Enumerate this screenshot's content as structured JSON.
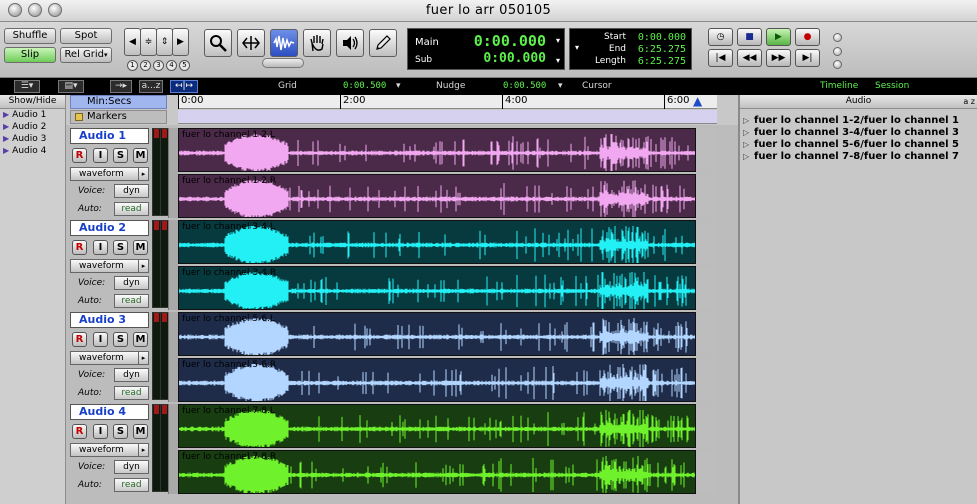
{
  "window": {
    "title": "fuer lo arr 050105"
  },
  "modes": {
    "shuffle": "Shuffle",
    "spot": "Spot",
    "slip": "Slip",
    "relgrid": "Rel Grid"
  },
  "zoom_presets": [
    "1",
    "2",
    "3",
    "4",
    "5"
  ],
  "counter": {
    "main_label": "Main",
    "main_value": "0:00.000",
    "sub_label": "Sub",
    "sub_value": "0:00.000"
  },
  "selection": {
    "start_label": "Start",
    "start_value": "0:00.000",
    "end_label": "End",
    "end_value": "6:25.275",
    "length_label": "Length",
    "length_value": "6:25.275"
  },
  "rulerbar": {
    "az": "a...z",
    "grid_label": "Grid",
    "grid_value": "0:00.500",
    "nudge_label": "Nudge",
    "nudge_value": "0:00.500",
    "cursor_label": "Cursor",
    "timeline_tab": "Timeline",
    "session_tab": "Session"
  },
  "showhide": {
    "header": "Show/Hide",
    "items": [
      "Audio 1",
      "Audio 2",
      "Audio 3",
      "Audio 4"
    ]
  },
  "timeline": {
    "ruler_label": "Min:Secs",
    "markers_label": "Markers",
    "ticks": [
      "0:00",
      "2:00",
      "4:00",
      "6:00"
    ]
  },
  "tracks": [
    {
      "name": "Audio 1",
      "rec": "R",
      "input": "I",
      "solo": "S",
      "mute": "M",
      "view": "waveform",
      "voice_label": "Voice:",
      "voice": "dyn",
      "auto_label": "Auto:",
      "auto": "read",
      "color": "#f2a8f0",
      "bg": "#4a2a48",
      "regions": [
        "fuer lo channel 1-2.L",
        "fuer lo channel 1-2.R"
      ]
    },
    {
      "name": "Audio 2",
      "rec": "R",
      "input": "I",
      "solo": "S",
      "mute": "M",
      "view": "waveform",
      "voice_label": "Voice:",
      "voice": "dyn",
      "auto_label": "Auto:",
      "auto": "read",
      "color": "#22f0f4",
      "bg": "#063a3e",
      "regions": [
        "fuer lo channel 3-4.L",
        "fuer lo channel 3-4.R"
      ]
    },
    {
      "name": "Audio 3",
      "rec": "R",
      "input": "I",
      "solo": "S",
      "mute": "M",
      "view": "waveform",
      "voice_label": "Voice:",
      "voice": "dyn",
      "auto_label": "Auto:",
      "auto": "read",
      "color": "#b2d6ff",
      "bg": "#1e2c4a",
      "regions": [
        "fuer lo channel 5-6.L",
        "fuer lo channel 5-6.R"
      ]
    },
    {
      "name": "Audio 4",
      "rec": "R",
      "input": "I",
      "solo": "S",
      "mute": "M",
      "view": "waveform",
      "voice_label": "Voice:",
      "voice": "dyn",
      "auto_label": "Auto:",
      "auto": "read",
      "color": "#6ff22c",
      "bg": "#173d10",
      "regions": [
        "fuer lo channel 7-8.L",
        "fuer lo channel 7-8.R"
      ]
    }
  ],
  "regions_list": {
    "header": "Audio",
    "sort": "a z",
    "items": [
      "fuer lo channel 1-2/fuer lo channel 1",
      "fuer lo channel 3-4/fuer lo channel 3",
      "fuer lo channel 5-6/fuer lo channel 5",
      "fuer lo channel 7-8/fuer lo channel 7"
    ]
  }
}
